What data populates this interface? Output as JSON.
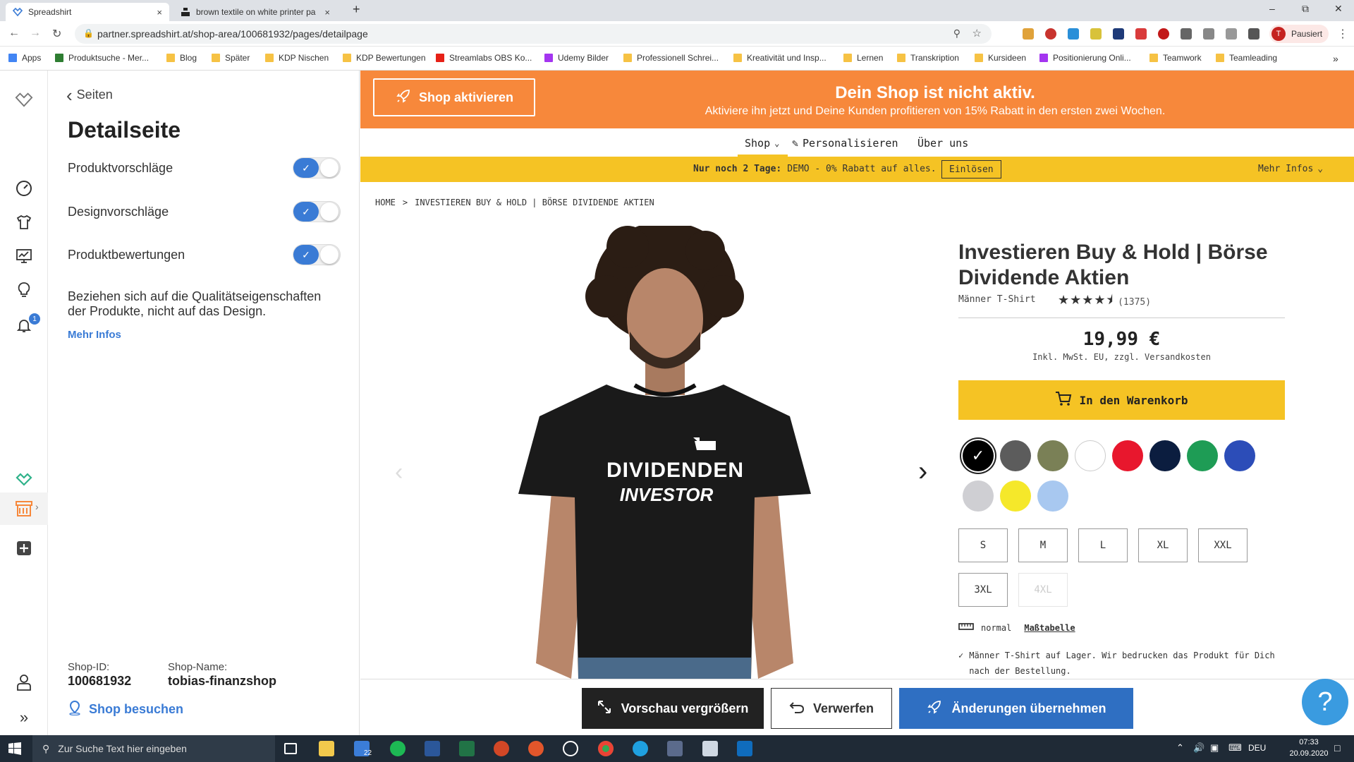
{
  "browser": {
    "tabs": [
      {
        "title": "Spreadshirt",
        "close": "×"
      },
      {
        "title": "brown textile on white printer pa",
        "close": "×"
      }
    ],
    "new_tab": "+",
    "url": "partner.spreadshirt.at/shop-area/100681932/pages/detailpage",
    "profile_initial": "T",
    "profile_label": "Pausiert",
    "bookmarks": [
      "Apps",
      "Produktsuche - Mer...",
      "Blog",
      "Später",
      "KDP Nischen",
      "KDP Bewertungen",
      "Streamlabs OBS Ko...",
      "Udemy Bilder",
      "Professionell Schrei...",
      "Kreativität und Insp...",
      "Lernen",
      "Transkription",
      "Kursideen",
      "Positionierung Onli...",
      "Teamwork",
      "Teamleading"
    ]
  },
  "rail": {
    "notification_count": "1"
  },
  "panel": {
    "back_label": "Seiten",
    "title": "Detailseite",
    "toggles": [
      {
        "label": "Produktvorschläge",
        "on": true
      },
      {
        "label": "Designvorschläge",
        "on": true
      },
      {
        "label": "Produktbewertungen",
        "on": true
      }
    ],
    "description": "Beziehen sich auf die Qualitätseigenschaften der Produkte, nicht auf das Design.",
    "more_info": "Mehr Infos",
    "shop_id_label": "Shop-ID:",
    "shop_id": "100681932",
    "shop_name_label": "Shop-Name:",
    "shop_name": "tobias-finanzshop",
    "visit_shop": "Shop besuchen"
  },
  "banner": {
    "button": "Shop aktivieren",
    "title": "Dein Shop ist nicht aktiv.",
    "subtitle": "Aktiviere ihn jetzt und Deine Kunden profitieren von 15% Rabatt in den ersten zwei Wochen."
  },
  "shopnav": {
    "shop": "Shop",
    "personalize": "Personalisieren",
    "about": "Über uns"
  },
  "promo": {
    "text_bold": "Nur noch 2 Tage:",
    "text": "DEMO - 0% Rabatt auf alles.",
    "redeem": "Einlösen",
    "more": "Mehr Infos"
  },
  "breadcrumb": [
    "HOME",
    ">",
    "INVESTIEREN BUY & HOLD | BÖRSE DIVIDENDE AKTIEN"
  ],
  "shirt_print": {
    "line1": "DIVIDENDEN",
    "line2": "INVESTOR"
  },
  "product": {
    "title": "Investieren Buy & Hold | Börse Dividende Aktien",
    "type": "Männer T-Shirt",
    "rating": 4.5,
    "rating_count": "(1375)",
    "price": "19,99 €",
    "price_note": "Inkl. MwSt. EU, zzgl. Versandkosten",
    "cart_button": "In den Warenkorb",
    "colors": [
      "#000000",
      "#5c5c5c",
      "#7a8056",
      "#ffffff",
      "#e8172d",
      "#0b1d3f",
      "#1e9c55",
      "#2c4db8",
      "#cfcfd3",
      "#f5e82a",
      "#a8c8f0"
    ],
    "sizes": [
      {
        "label": "S",
        "available": true
      },
      {
        "label": "M",
        "available": true
      },
      {
        "label": "L",
        "available": true
      },
      {
        "label": "XL",
        "available": true
      },
      {
        "label": "XXL",
        "available": true
      },
      {
        "label": "3XL",
        "available": true
      },
      {
        "label": "4XL",
        "available": false
      }
    ],
    "fit": "normal",
    "size_chart": "Maßtabelle",
    "stock_note": "Männer T-Shirt auf Lager. Wir bedrucken das Produkt für Dich nach der Bestellung."
  },
  "actions": {
    "preview": "Vorschau vergrößern",
    "discard": "Verwerfen",
    "apply": "Änderungen übernehmen"
  },
  "help": "?",
  "taskbar": {
    "search": "Zur Suche Text hier eingeben",
    "mail_badge": "22",
    "lang": "DEU",
    "time": "07:33",
    "date": "20.09.2020"
  },
  "colors": {
    "accent": "#3a7bd5",
    "banner": "#f7883b",
    "promo": "#f5c324",
    "cart": "#f5c324",
    "apply": "#2f6fc2"
  }
}
